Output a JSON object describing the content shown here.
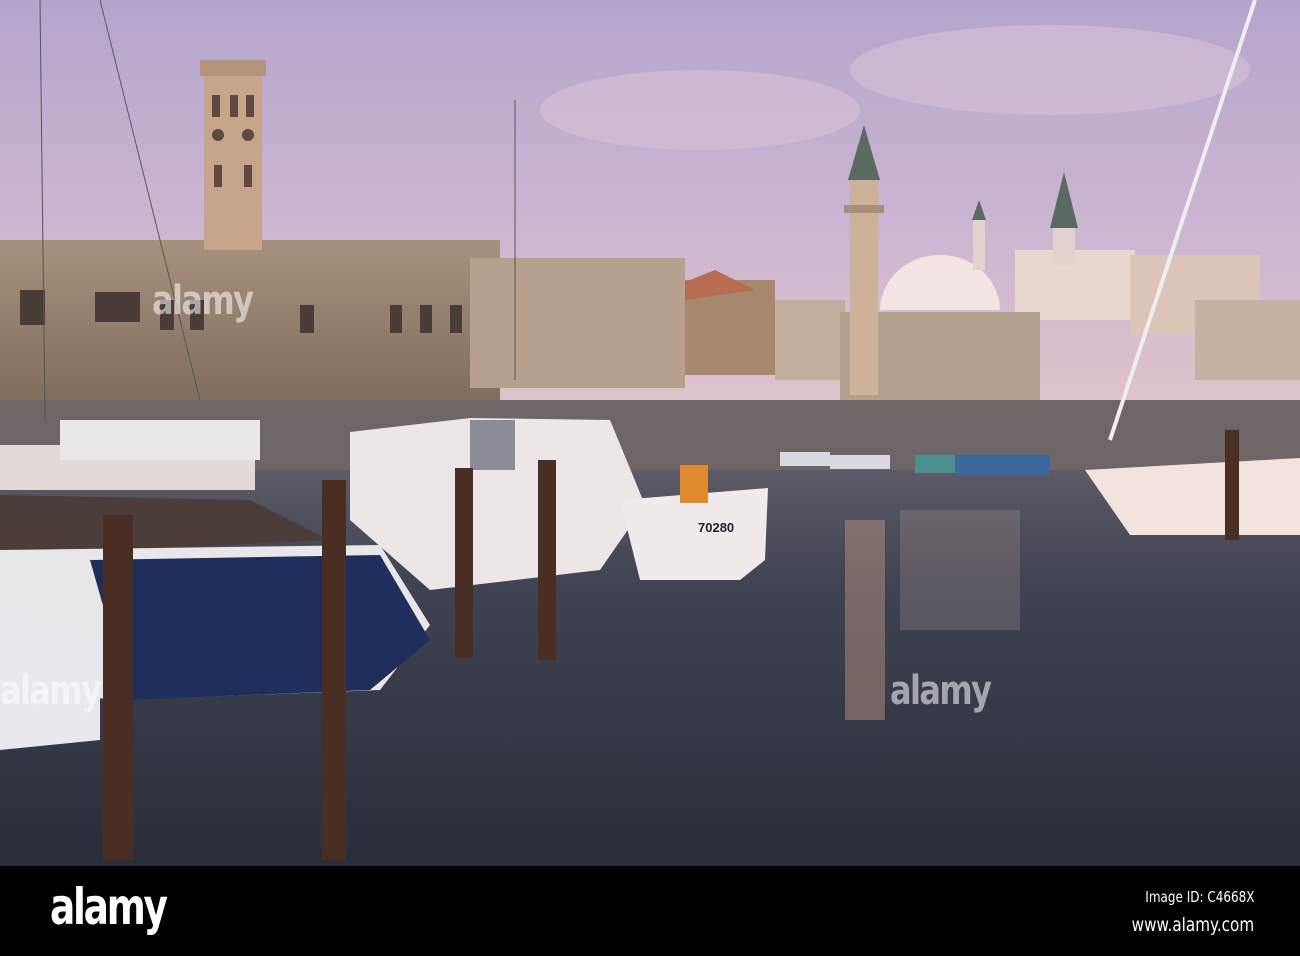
{
  "photo": {
    "boat_number": "70280",
    "watermark": "alamy"
  },
  "footer": {
    "logo": "alamy",
    "image_id": "Image ID: C4668X",
    "url": "www.alamy.com"
  }
}
